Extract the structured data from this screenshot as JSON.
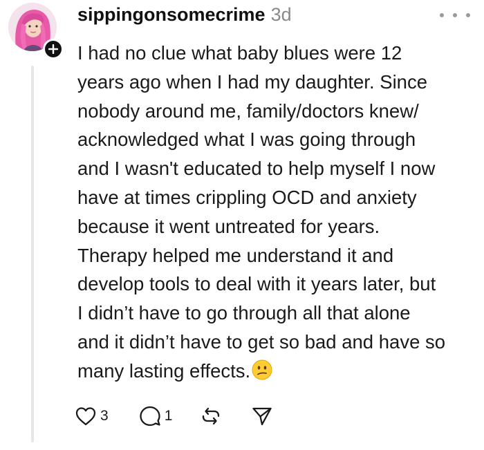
{
  "post": {
    "author": "sippingonsomecrime",
    "time": "3d",
    "lines": [
      "I had no clue what baby blues were 12",
      "years ago when I had my daughter. Since",
      "nobody around me, family/doctors knew/",
      "acknowledged what I was going through",
      "and I wasn't educated to help myself I now",
      "have at times crippling OCD and anxiety",
      "because it went untreated for years.",
      "Therapy helped me understand it and",
      "develop tools to deal with it years later, but",
      "I didn’t have to go through all that alone",
      "and it didn’t have to get so bad and have so",
      "many lasting effects."
    ],
    "emoji": "confused-face"
  },
  "actions": {
    "like_count": "3",
    "reply_count": "1"
  },
  "icons": {
    "like": "heart-icon",
    "reply": "comment-bubble-icon",
    "repost": "repost-arrows-icon",
    "share": "send-icon",
    "more": "more-dots-icon",
    "follow": "plus-icon"
  },
  "colors": {
    "text": "#1a1a1a",
    "muted": "#8a8a8a",
    "thread_line": "#e6e6e6",
    "avatar_hair": "#e85aa8"
  }
}
